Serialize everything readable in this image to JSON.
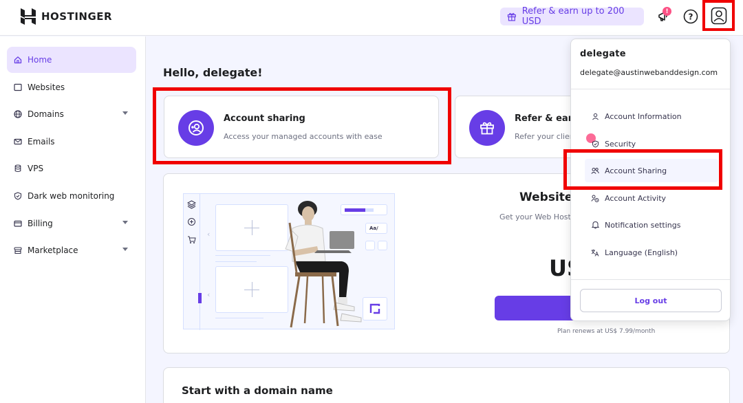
{
  "brand": {
    "name": "HOSTINGER"
  },
  "header": {
    "refer_label": "Refer & earn up to 200 USD",
    "notification_count": "!",
    "help_glyph": "?"
  },
  "sidebar": {
    "items": [
      {
        "label": "Home",
        "icon": "home-icon",
        "active": true
      },
      {
        "label": "Websites",
        "icon": "website-icon"
      },
      {
        "label": "Domains",
        "icon": "globe-icon",
        "expandable": true
      },
      {
        "label": "Emails",
        "icon": "mail-icon"
      },
      {
        "label": "VPS",
        "icon": "server-icon"
      },
      {
        "label": "Dark web monitoring",
        "icon": "shield-icon"
      },
      {
        "label": "Billing",
        "icon": "billing-icon",
        "expandable": true
      },
      {
        "label": "Marketplace",
        "icon": "marketplace-icon",
        "expandable": true
      }
    ]
  },
  "main": {
    "greeting": "Hello, delegate!",
    "cards": [
      {
        "title": "Account sharing",
        "description": "Access your managed accounts with ease"
      },
      {
        "title": "Refer & earn",
        "description": "Refer your clien"
      }
    ],
    "promo": {
      "title": "Website B",
      "subtitle": "Get your Web Hosti",
      "price": "US",
      "renew": "Plan renews at US$ 7.99/month",
      "illustration_button": "Aa/"
    },
    "domain_section_title": "Start with a domain name"
  },
  "dropdown": {
    "name": "delegate",
    "email": "delegate@austinwebanddesign.com",
    "items": [
      {
        "label": "Account Information",
        "icon": "user-icon"
      },
      {
        "label": "Security",
        "icon": "shield-check-icon"
      },
      {
        "label": "Account Sharing",
        "icon": "users-icon"
      },
      {
        "label": "Account Activity",
        "icon": "user-activity-icon"
      },
      {
        "label": "Notification settings",
        "icon": "bell-icon"
      },
      {
        "label": "Language (English)",
        "icon": "translate-icon"
      }
    ],
    "logout_label": "Log out"
  },
  "colors": {
    "brand_purple": "#673de6",
    "highlight_red": "#f00000",
    "accent_pink": "#fc5185"
  }
}
